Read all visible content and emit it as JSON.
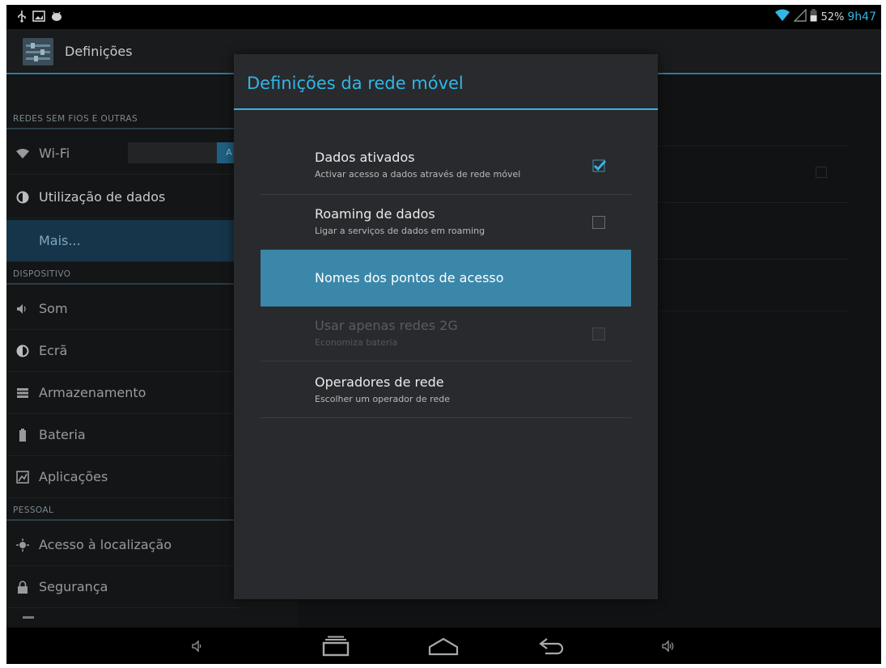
{
  "status_bar": {
    "left_icons": [
      "usb-icon",
      "screenshot-icon",
      "android-debug-icon"
    ],
    "battery_percent": "52%",
    "time": "9h47"
  },
  "action_bar": {
    "title": "Definições"
  },
  "settings_list": {
    "sections": [
      {
        "header": "REDES SEM FIOS E OUTRAS"
      },
      {
        "header": "DISPOSITIVO"
      },
      {
        "header": "PESSOAL"
      }
    ],
    "items": [
      {
        "label": "Wi-Fi",
        "icon": "wifi-icon",
        "switch_label": "A"
      },
      {
        "label": "Utilização de dados",
        "icon": "data-usage-icon"
      },
      {
        "label": "Mais...",
        "active": true
      },
      {
        "label": "Som",
        "icon": "speaker-icon"
      },
      {
        "label": "Ecrã",
        "icon": "display-icon"
      },
      {
        "label": "Armazenamento",
        "icon": "storage-icon"
      },
      {
        "label": "Bateria",
        "icon": "battery-icon"
      },
      {
        "label": "Aplicações",
        "icon": "apps-icon"
      },
      {
        "label": "Acesso à localização",
        "icon": "location-icon"
      },
      {
        "label": "Segurança",
        "icon": "lock-icon"
      }
    ]
  },
  "dialog": {
    "title": "Definições da rede móvel",
    "items": [
      {
        "primary": "Dados ativados",
        "secondary": "Activar acesso a dados através de rede móvel",
        "checked": true
      },
      {
        "primary": "Roaming de dados",
        "secondary": "Ligar a serviços de dados em roaming",
        "checked": false
      },
      {
        "primary": "Nomes dos pontos de acesso",
        "selected": true
      },
      {
        "primary": "Usar apenas redes 2G",
        "secondary": "Economiza bateria",
        "checked": false,
        "disabled": true
      },
      {
        "primary": "Operadores de rede",
        "secondary": "Escolher um operador de rede"
      }
    ]
  },
  "nav_bar": {
    "buttons": [
      "volume-down-icon",
      "recent-apps-icon",
      "home-icon",
      "back-icon",
      "volume-up-icon"
    ]
  },
  "colors": {
    "accent": "#33b5e5",
    "selected_row": "#3b87aa",
    "dialog_bg": "#282a2d"
  }
}
